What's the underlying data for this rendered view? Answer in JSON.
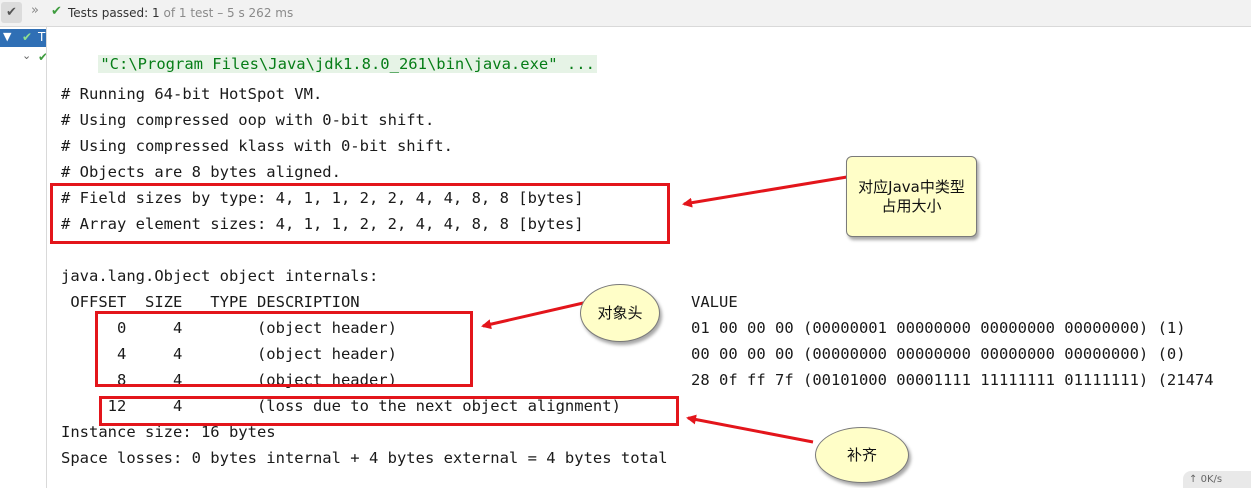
{
  "status_bar": {
    "pass_label": "Tests passed:",
    "pass_count": "1",
    "total_text": "of 1 test",
    "duration": "– 5 s 262 ms"
  },
  "tree": {
    "item1_label": "T"
  },
  "console": {
    "command": "\"C:\\Program Files\\Java\\jdk1.8.0_261\\bin\\java.exe\" ...",
    "header_lines": [
      "# Running 64-bit HotSpot VM.",
      "# Using compressed oop with 0-bit shift.",
      "# Using compressed klass with 0-bit shift.",
      "# Objects are 8 bytes aligned.",
      "# Field sizes by type: 4, 1, 1, 2, 2, 4, 4, 8, 8 [bytes]",
      "# Array element sizes: 4, 1, 1, 2, 2, 4, 4, 8, 8 [bytes]"
    ],
    "object_title": "java.lang.Object object internals:",
    "columns_header": " OFFSET  SIZE   TYPE DESCRIPTION",
    "value_header": "VALUE",
    "rows": [
      {
        "left": "      0     4        (object header)",
        "value": "01 00 00 00 (00000001 00000000 00000000 00000000) (1)"
      },
      {
        "left": "      4     4        (object header)",
        "value": "00 00 00 00 (00000000 00000000 00000000 00000000) (0)"
      },
      {
        "left": "      8     4        (object header)",
        "value": "28 0f ff 7f (00101000 00001111 11111111 01111111) (21474"
      },
      {
        "left": "     12     4        (loss due to the next object alignment)",
        "value": ""
      }
    ],
    "instance_size": "Instance size: 16 bytes",
    "space_losses": "Space losses: 0 bytes internal + 4 bytes external = 4 bytes total"
  },
  "annotations": {
    "type_size_note": "对应Java中类型占用大小",
    "object_header_note": "对象头",
    "padding_note": "补齐",
    "accent_color": "#e3151b",
    "note_bg": "#fffec8"
  },
  "speed_widget": {
    "arrow": "↑",
    "text": "0K/s"
  }
}
